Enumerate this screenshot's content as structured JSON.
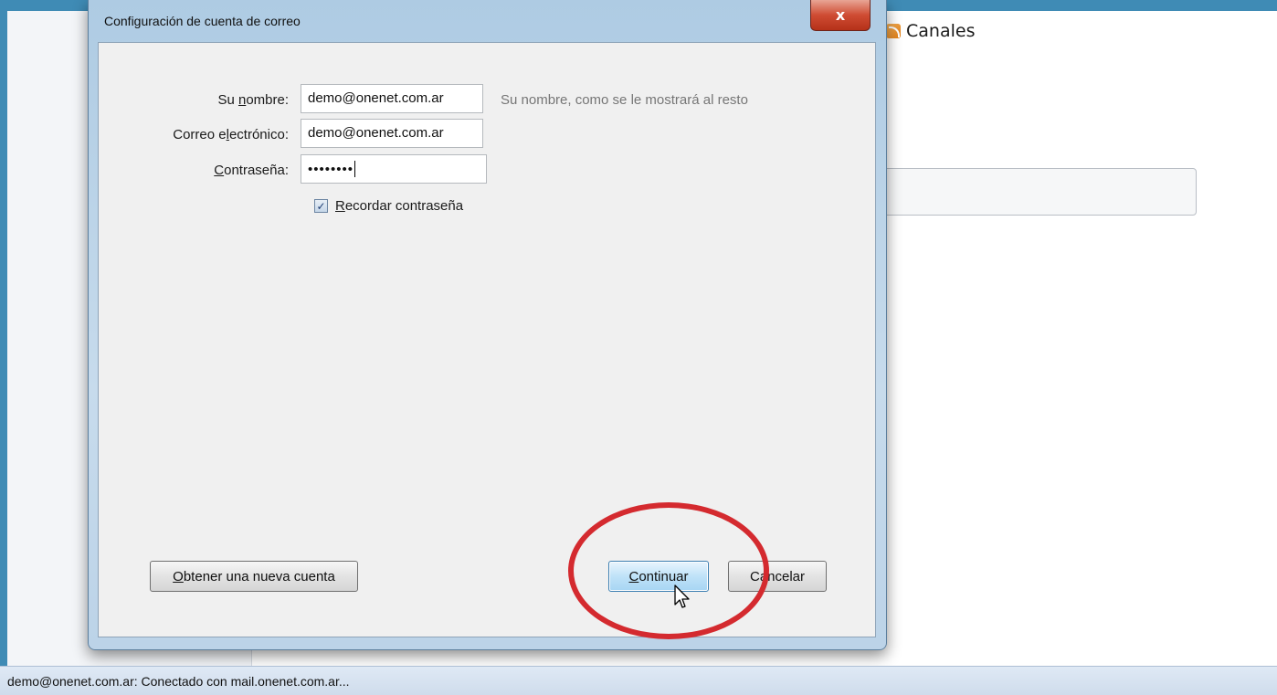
{
  "background": {
    "feeds_label": "Canales"
  },
  "dialog": {
    "title": "Configuración de cuenta de correo",
    "close_glyph": "x",
    "name": {
      "label_pre": "Su ",
      "label_accel": "n",
      "label_post": "ombre:",
      "value": "demo@onenet.com.ar",
      "hint": "Su nombre, como se le mostrará al resto"
    },
    "email": {
      "label_pre": "Correo e",
      "label_accel": "l",
      "label_post": "ectrónico:",
      "value": "demo@onenet.com.ar"
    },
    "password": {
      "label_pre": "",
      "label_accel": "C",
      "label_post": "ontraseña:",
      "masked_value": "••••••••"
    },
    "remember": {
      "checked": true,
      "check_glyph": "✓",
      "label_accel": "R",
      "label_post": "ecordar contraseña"
    },
    "buttons": {
      "new_account_accel": "O",
      "new_account_post": "btener una nueva cuenta",
      "continue_accel": "C",
      "continue_post": "ontinuar",
      "cancel_label": "Cancelar"
    }
  },
  "status_bar": {
    "text": "demo@onenet.com.ar: Conectado con mail.onenet.com.ar..."
  },
  "colors": {
    "highlight_ring": "#d42a2f",
    "primary_button": "#bfe2f8",
    "close_button": "#cf4c33"
  }
}
